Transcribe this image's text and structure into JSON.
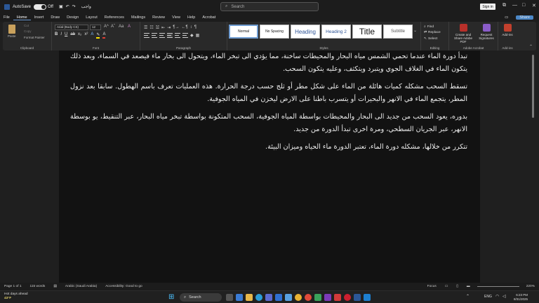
{
  "titlebar": {
    "autosave_label": "AutoSave",
    "autosave_state": "Off",
    "doc_name": "واجب",
    "search_placeholder": "Search",
    "signin_label": "Sign in"
  },
  "menu": {
    "tabs": [
      "File",
      "Home",
      "Insert",
      "Draw",
      "Design",
      "Layout",
      "References",
      "Mailings",
      "Review",
      "View",
      "Help",
      "Acrobat"
    ],
    "active_tab": "Home",
    "share_label": "Share"
  },
  "ribbon": {
    "clipboard": {
      "paste": "Paste",
      "cut": "Cut",
      "copy": "Copy",
      "format_painter": "Format Painter",
      "group": "Clipboard"
    },
    "font": {
      "family": "Arial (Body CS)",
      "size": "12",
      "group": "Font"
    },
    "paragraph": {
      "group": "Paragraph"
    },
    "styles": {
      "items": [
        "Normal",
        "No Spacing",
        "Heading",
        "Heading 2",
        "Title",
        "Subtitle"
      ],
      "group": "Styles"
    },
    "editing": {
      "find": "Find",
      "replace": "Replace",
      "select": "Select",
      "group": "Editing"
    },
    "acrobat": {
      "create_share": "Create and Share Adobe PDF",
      "request_sig": "Request Signatures",
      "group": "Adobe Acrobat"
    },
    "addins": {
      "label": "Add-ins",
      "group": "Add-ins"
    }
  },
  "document": {
    "paragraphs": [
      "تبدأ دورة الماء عندما تحمي الشمس مياه البحار والمحيطات ساخنة، مما يؤدي الى تبخر الماء، ويتحول الى بخار ماء فيصعد في السماء، وبعد ذلك يتكون الماء في الغلاف الجوي ويتبرد ويتكثف، وعليه يتكون السحب.",
      "تسقط السحب مشكله كميات هائلة من الماء على شكل مطر أو ثلج حسب درجة الحرارة. هذه العمليات تعرف باسم الهطول. سابقا بعد نزول المطر، يتجمع الماء في الانهر والبحيرات أو يتسرب باطنا على الارض ليخزن في المياه الجوفية.",
      "بدوره، يعود السحب من جديد الى البحار والمحيطات بواسطة المياه الجوفية، السحب المتكونة بواسطة تبخر مياه البحار، عبر التنقيط، يو بوسطة الانهر، عبر الجريان السطحي، ومرة اخرى تبدأ الدورة من جديد.",
      "تتكرر من خلالها، مشكله دورة الماء، تعتبر الدورة ماء الحياه وميزان البيئة."
    ]
  },
  "status": {
    "page": "Page 1 of 1",
    "words": "115 words",
    "language": "Arabic (Saudi Arabia)",
    "accessibility": "Accessibility: Good to go",
    "focus": "Focus",
    "zoom": "220%"
  },
  "taskbar": {
    "weather_title": "Hot days ahead",
    "weather_temp": "43°F",
    "search": "Search",
    "lang": "ENG",
    "time": "6:23 PM",
    "date": "8/31/2025"
  }
}
